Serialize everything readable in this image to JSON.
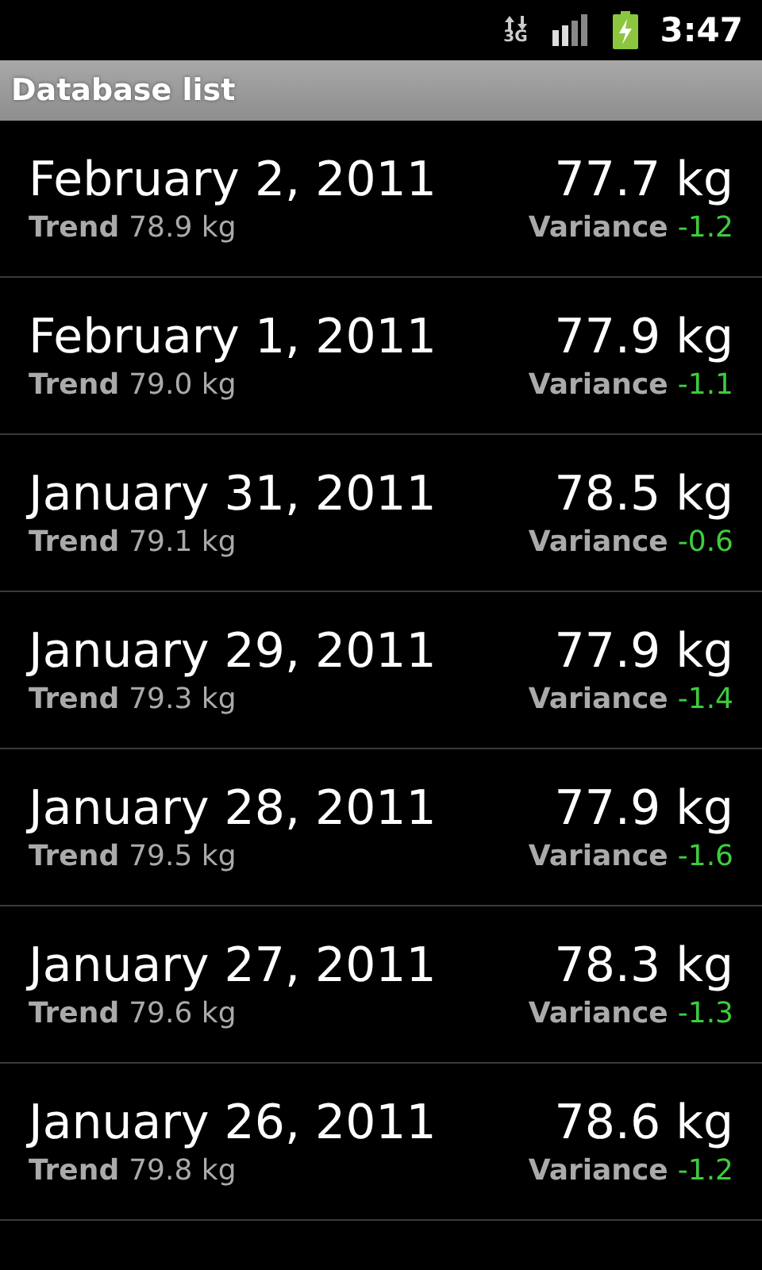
{
  "status_bar": {
    "network": "3G",
    "time": "3:47"
  },
  "title_bar": {
    "title": "Database list"
  },
  "entries": [
    {
      "date": "February 2, 2011",
      "weight": "77.7 kg",
      "trend_label": "Trend",
      "trend": "78.9 kg",
      "variance_label": "Variance",
      "variance": "-1.2"
    },
    {
      "date": "February 1, 2011",
      "weight": "77.9 kg",
      "trend_label": "Trend",
      "trend": "79.0 kg",
      "variance_label": "Variance",
      "variance": "-1.1"
    },
    {
      "date": "January 31, 2011",
      "weight": "78.5 kg",
      "trend_label": "Trend",
      "trend": "79.1 kg",
      "variance_label": "Variance",
      "variance": "-0.6"
    },
    {
      "date": "January 29, 2011",
      "weight": "77.9 kg",
      "trend_label": "Trend",
      "trend": "79.3 kg",
      "variance_label": "Variance",
      "variance": "-1.4"
    },
    {
      "date": "January 28, 2011",
      "weight": "77.9 kg",
      "trend_label": "Trend",
      "trend": "79.5 kg",
      "variance_label": "Variance",
      "variance": "-1.6"
    },
    {
      "date": "January 27, 2011",
      "weight": "78.3 kg",
      "trend_label": "Trend",
      "trend": "79.6 kg",
      "variance_label": "Variance",
      "variance": "-1.3"
    },
    {
      "date": "January 26, 2011",
      "weight": "78.6 kg",
      "trend_label": "Trend",
      "trend": "79.8 kg",
      "variance_label": "Variance",
      "variance": "-1.2"
    }
  ]
}
